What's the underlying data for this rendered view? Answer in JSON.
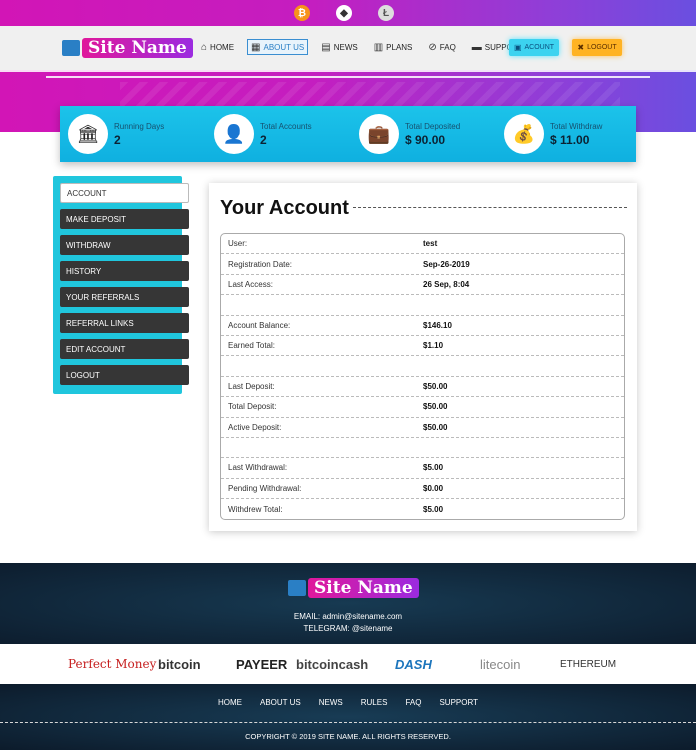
{
  "header": {
    "crypto_icons": [
      "bitcoin-icon",
      "ethereum-icon",
      "litecoin-icon"
    ],
    "logo_text": "Site Name",
    "nav": [
      {
        "label": "HOME",
        "icon": "home-icon"
      },
      {
        "label": "ABOUT US",
        "icon": "info-icon"
      },
      {
        "label": "NEWS",
        "icon": "news-icon"
      },
      {
        "label": "PLANS",
        "icon": "book-icon"
      },
      {
        "label": "FAQ",
        "icon": "paperclip-icon"
      },
      {
        "label": "SUPPORT",
        "icon": "chat-icon"
      }
    ],
    "account_label": "ACOUNT",
    "logout_label": "LOGOUT"
  },
  "stats": [
    {
      "label": "Running Days",
      "value": "2",
      "icon": "bank-icon"
    },
    {
      "label": "Total Accounts",
      "value": "2",
      "icon": "user-icon"
    },
    {
      "label": "Total Deposited",
      "value": "$ 90.00",
      "icon": "briefcase-icon"
    },
    {
      "label": "Total Withdraw",
      "value": "$ 11.00",
      "icon": "coins-icon"
    }
  ],
  "sidebar": {
    "items": [
      "ACCOUNT",
      "MAKE DEPOSIT",
      "WITHDRAW",
      "HISTORY",
      "YOUR REFERRALS",
      "REFERRAL LINKS",
      "EDIT ACCOUNT",
      "LOGOUT"
    ]
  },
  "account": {
    "title": "Your Account",
    "rows": [
      {
        "k": "User:",
        "v": "test"
      },
      {
        "k": "Registration Date:",
        "v": "Sep-26-2019"
      },
      {
        "k": "Last Access:",
        "v": "26 Sep, 8:04"
      },
      {
        "k": "",
        "v": ""
      },
      {
        "k": "Account Balance:",
        "v": "$146.10"
      },
      {
        "k": "Earned Total:",
        "v": "$1.10"
      },
      {
        "k": "",
        "v": ""
      },
      {
        "k": "Last Deposit:",
        "v": "$50.00"
      },
      {
        "k": "Total Deposit:",
        "v": "$50.00"
      },
      {
        "k": "Active Deposit:",
        "v": "$50.00"
      },
      {
        "k": "",
        "v": ""
      },
      {
        "k": "Last Withdrawal:",
        "v": "$5.00"
      },
      {
        "k": "Pending Withdrawal:",
        "v": "$0.00"
      },
      {
        "k": "Withdrew Total:",
        "v": "$5.00"
      }
    ]
  },
  "footer": {
    "logo_text": "Site Name",
    "email": "EMAIL: admin@sitename.com",
    "telegram": "TELEGRAM: @sitename",
    "payments": [
      "Perfect Money",
      "bitcoin",
      "PAYEER",
      "bitcoincash",
      "DASH",
      "litecoin",
      "ETHEREUM"
    ],
    "nav": [
      "HOME",
      "ABOUT US",
      "NEWS",
      "RULES",
      "FAQ",
      "SUPPORT"
    ],
    "copyright": "COPYRIGHT © 2019 SITE NAME. ALL RIGHTS RESERVED."
  }
}
